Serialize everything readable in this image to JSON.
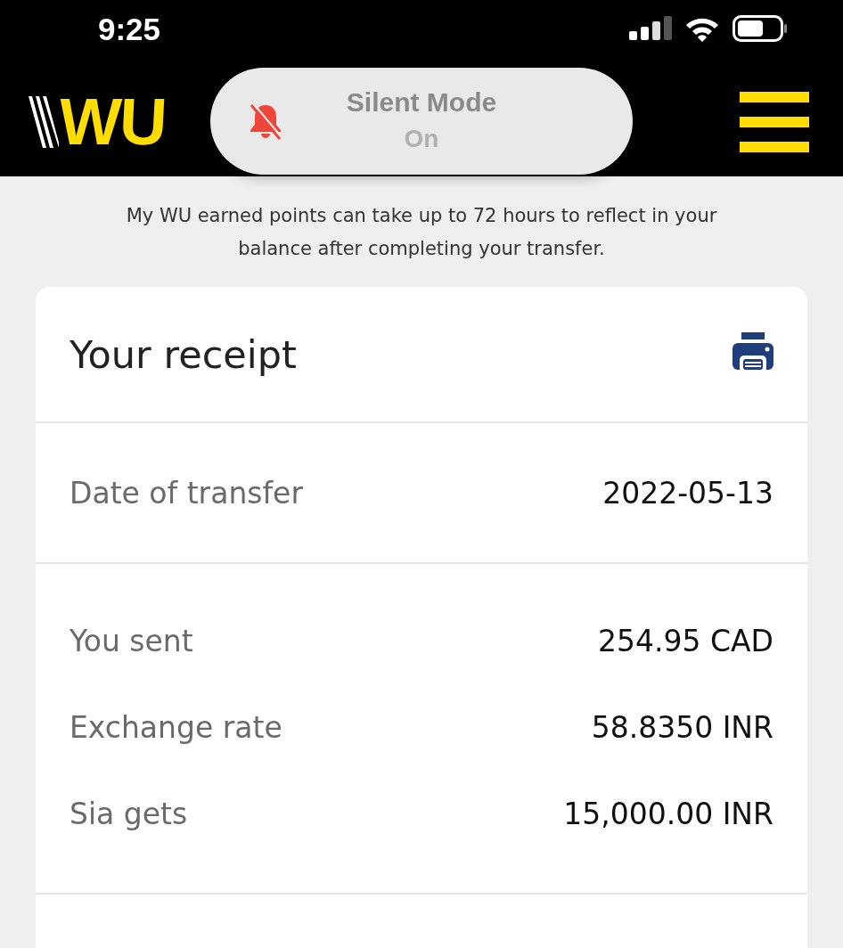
{
  "status_bar": {
    "time": "9:25"
  },
  "header": {
    "logo": "WU"
  },
  "silent_banner": {
    "title": "Silent Mode",
    "state": "On"
  },
  "notice": "My WU earned points can take up to 72 hours to reflect in your balance after completing your transfer.",
  "receipt": {
    "title": "Your receipt",
    "sections": [
      {
        "rows": [
          {
            "label": "Date of transfer",
            "value": "2022-05-13"
          }
        ]
      },
      {
        "rows": [
          {
            "label": "You sent",
            "value": "254.95 CAD"
          },
          {
            "label": "Exchange rate",
            "value": "58.8350 INR"
          },
          {
            "label": "Sia gets",
            "value": "15,000.00 INR"
          }
        ]
      }
    ]
  }
}
